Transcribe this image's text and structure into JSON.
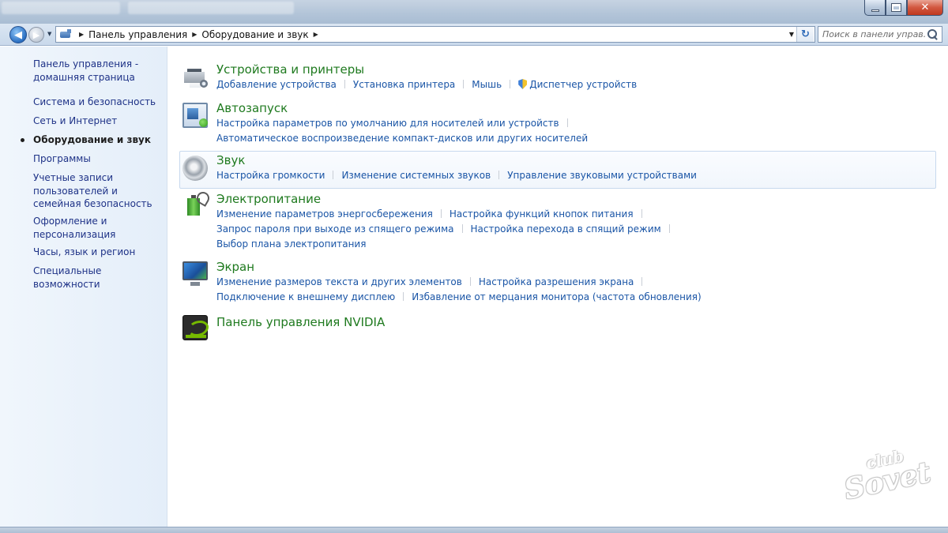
{
  "titlebar": {
    "tabs": [
      "",
      ""
    ],
    "close_glyph": "✕"
  },
  "nav": {
    "back_glyph": "◀",
    "forward_glyph": "▶",
    "breadcrumbs": [
      "Панель управления",
      "Оборудование и звук"
    ],
    "search_placeholder": "Поиск в панели управ...",
    "refresh_glyph": "↻"
  },
  "sidebar": {
    "items": [
      {
        "label": "Панель управления - домашняя страница"
      },
      {
        "label": "Система и безопасность"
      },
      {
        "label": "Сеть и Интернет"
      },
      {
        "label": "Оборудование и звук",
        "active": true
      },
      {
        "label": "Программы"
      },
      {
        "label": "Учетные записи пользователей и семейная безопасность"
      },
      {
        "label": "Оформление и персонализация"
      },
      {
        "label": "Часы, язык и регион"
      },
      {
        "label": "Специальные возможности"
      }
    ]
  },
  "categories": [
    {
      "title": "Устройства и принтеры",
      "icon": "devices-printers-icon",
      "link_rows": [
        [
          "Добавление устройства",
          "Установка принтера",
          "Мышь",
          "Диспетчер устройств"
        ]
      ]
    },
    {
      "title": "Автозапуск",
      "icon": "autoplay-icon",
      "link_rows": [
        [
          "Настройка параметров по умолчанию для носителей или устройств"
        ],
        [
          "Автоматическое воспроизведение компакт-дисков или других носителей"
        ]
      ]
    },
    {
      "title": "Звук",
      "icon": "speaker-icon",
      "link_rows": [
        [
          "Настройка громкости",
          "Изменение системных звуков",
          "Управление звуковыми устройствами"
        ]
      ]
    },
    {
      "title": "Электропитание",
      "icon": "battery-power-icon",
      "link_rows": [
        [
          "Изменение параметров энергосбережения",
          "Настройка функций кнопок питания"
        ],
        [
          "Запрос пароля при выходе из спящего режима",
          "Настройка перехода в спящий режим"
        ],
        [
          "Выбор плана электропитания"
        ]
      ]
    },
    {
      "title": "Экран",
      "icon": "monitor-icon",
      "link_rows": [
        [
          "Изменение размеров текста и других элементов",
          "Настройка разрешения экрана"
        ],
        [
          "Подключение к внешнему дисплею",
          "Избавление от мерцания монитора (частота обновления)"
        ]
      ]
    },
    {
      "title": "Панель управления NVIDIA",
      "icon": "nvidia-icon",
      "link_rows": []
    }
  ],
  "watermark": {
    "small": "club",
    "big": "Sovet"
  }
}
